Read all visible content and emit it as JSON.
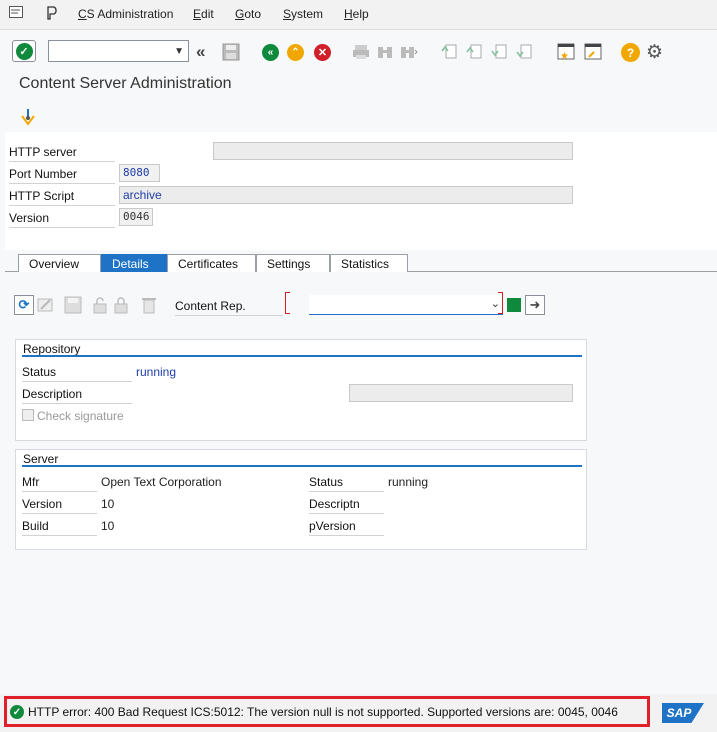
{
  "menu": {
    "items": [
      "CS Administration",
      "Edit",
      "Goto",
      "System",
      "Help"
    ]
  },
  "page": {
    "title": "Content Server Administration"
  },
  "form": {
    "http_server_label": "HTTP server",
    "http_server_value": "",
    "port_label": "Port Number",
    "port_value": "8080",
    "script_label": "HTTP Script",
    "script_value": "archive",
    "version_label": "Version",
    "version_value": "0046"
  },
  "tabs": [
    {
      "label": "Overview"
    },
    {
      "label": "Details"
    },
    {
      "label": "Certificates"
    },
    {
      "label": "Settings"
    },
    {
      "label": "Statistics"
    }
  ],
  "details": {
    "content_rep_label": "Content Rep.",
    "content_rep_value": ""
  },
  "repository": {
    "title": "Repository",
    "status_label": "Status",
    "status_value": "running",
    "description_label": "Description",
    "description_value": "",
    "check_signature_label": "Check signature"
  },
  "server": {
    "title": "Server",
    "mfr_label": "Mfr",
    "mfr_value": "Open Text Corporation",
    "version_label": "Version",
    "version_value": "10",
    "build_label": "Build",
    "build_value": "10",
    "status_label": "Status",
    "status_value": "running",
    "descriptn_label": "Descriptn",
    "descriptn_value": "",
    "pversion_label": "pVersion",
    "pversion_value": ""
  },
  "status_bar": {
    "message": "HTTP error: 400 Bad Request  ICS:5012: The version null is not supported. Supported versions are: 0045, 0046",
    "logo": "SAP"
  },
  "colors": {
    "accent": "#1e73c7",
    "ok_green": "#0f8a3c",
    "error_red": "#e0202a",
    "help_orange": "#f0a800"
  }
}
